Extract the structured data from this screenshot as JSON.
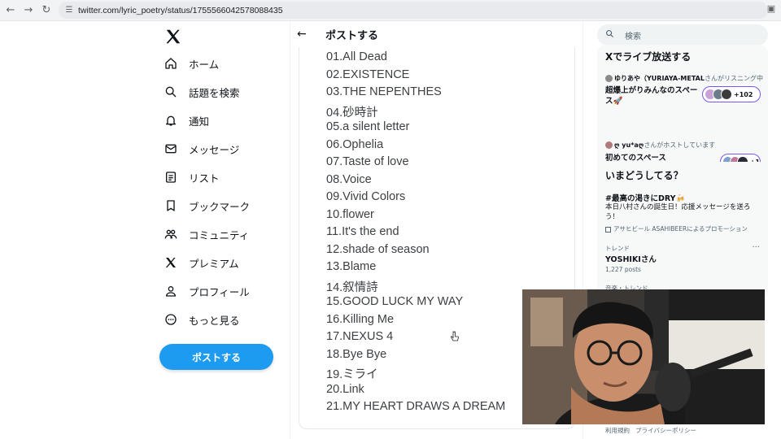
{
  "browser": {
    "url": "twitter.com/lyric_poetry/status/1755566042578088435"
  },
  "nav": {
    "items": [
      {
        "label": "ホーム",
        "icon": "home-icon"
      },
      {
        "label": "話題を検索",
        "icon": "search-icon"
      },
      {
        "label": "通知",
        "icon": "bell-icon"
      },
      {
        "label": "メッセージ",
        "icon": "mail-icon"
      },
      {
        "label": "リスト",
        "icon": "list-icon"
      },
      {
        "label": "ブックマーク",
        "icon": "bookmark-icon"
      },
      {
        "label": "コミュニティ",
        "icon": "community-icon"
      },
      {
        "label": "プレミアム",
        "icon": "x-icon"
      },
      {
        "label": "プロフィール",
        "icon": "person-icon"
      },
      {
        "label": "もっと見る",
        "icon": "more-circle-icon"
      }
    ],
    "post_button": "ポストする"
  },
  "main": {
    "header_title": "ポストする",
    "tracks": [
      "01.All Dead",
      "02.EXISTENCE",
      "03.THE NEPENTHES",
      "04.砂時計",
      "05.a silent letter",
      "06.Ophelia",
      "07.Taste of love",
      "08.Voice",
      "09.Vivid Colors",
      "10.flower",
      "11.It's the end",
      "12.shade of season",
      "13.Blame",
      "14.叙情詩",
      "15.GOOD LUCK MY WAY",
      "16.Killing Me",
      "17.NEXUS 4",
      "18.Bye Bye",
      "19.ミライ",
      "20.Link",
      "21.MY HEART DRAWS A DREAM"
    ]
  },
  "sidebar": {
    "search_placeholder": "検索",
    "live": {
      "title": "Xでライブ放送する",
      "spaces": [
        {
          "host": "ゆりあや（YURIAYA-METAL",
          "host_suffix": "さんがリスニング中",
          "title_line1": "超爆上がりみんなのスペー",
          "title_line2": "ス🚀",
          "count": "+102"
        },
        {
          "host": "ღ yu*aღ",
          "host_suffix": "さんがホストしています",
          "title_line1": "初めてのスペース",
          "title_line2": "",
          "count": "+1"
        }
      ]
    },
    "trends": {
      "title": "いまどうしてる？",
      "promo": {
        "name": "#最高の渇きにDRY🍻",
        "sub": "本日八村さんの誕生日！応援メッセージを送ろう！",
        "by": "アサヒビール ASAHIBEERによるプロモーション"
      },
      "trend": {
        "label": "トレンド",
        "name": "YOSHIKIさん",
        "count": "1,227 posts",
        "more": "···"
      },
      "partial_label": "音楽・トレンド"
    },
    "footer": {
      "terms": "利用規約",
      "privacy": "プライバシーポリシー"
    }
  }
}
